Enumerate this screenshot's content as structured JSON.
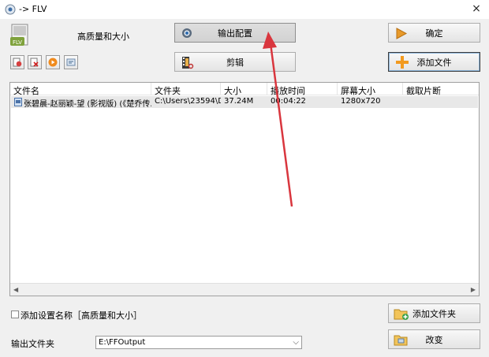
{
  "window": {
    "title": "-> FLV",
    "close_label": "×"
  },
  "profile": {
    "label": "高质量和大小"
  },
  "buttons": {
    "output_config": "输出配置",
    "ok": "确定",
    "clip": "剪辑",
    "add_file": "添加文件",
    "add_folder": "添加文件夹",
    "change": "改变"
  },
  "toolbar_icons": [
    "remove-file-icon",
    "clear-list-icon",
    "play-icon",
    "media-info-icon"
  ],
  "list": {
    "columns": [
      "文件名",
      "文件夹",
      "大小",
      "播放时间",
      "屏幕大小",
      "截取片断"
    ],
    "rows": [
      {
        "name": "张碧晨-赵丽颖-望 (影视版) (《楚乔传...",
        "folder": "C:\\Users\\23594\\De...",
        "size": "37.24M",
        "duration": "00:04:22",
        "screen": "1280x720",
        "clip": ""
      }
    ]
  },
  "settings": {
    "add_name_label": "添加设置名称［高质量和大小］",
    "add_name_checked": false
  },
  "output": {
    "label": "输出文件夹",
    "folder": "E:\\FFOutput"
  },
  "colors": {
    "arrow": "#d9363e",
    "list_row": "#e8e8e8"
  }
}
